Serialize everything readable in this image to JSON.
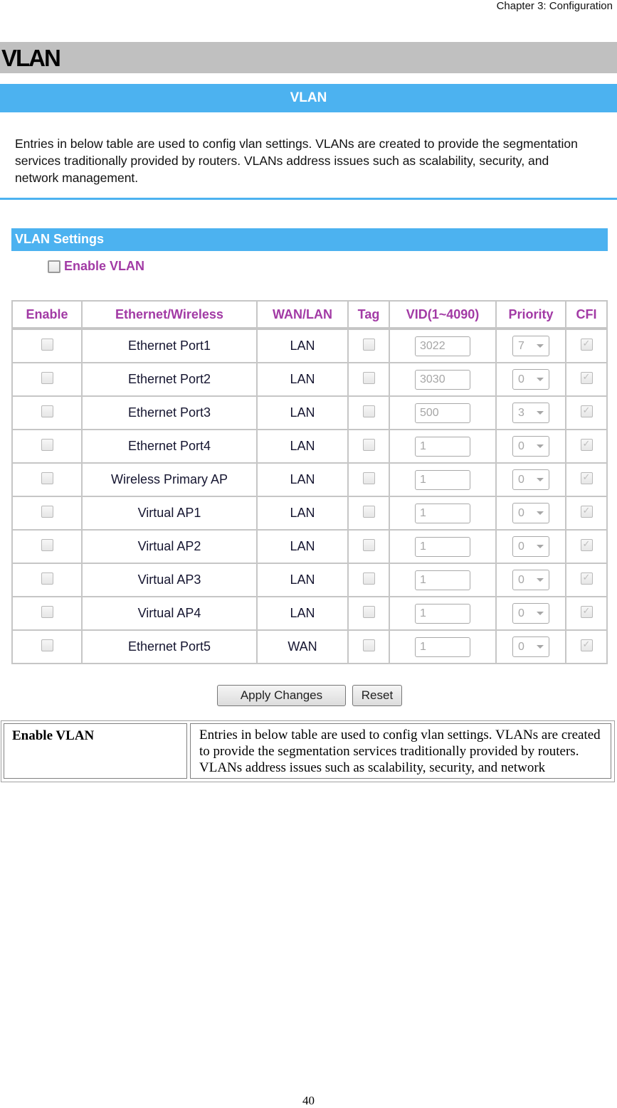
{
  "page": {
    "chapter_header": "Chapter 3: Configuration",
    "section_title": "VLAN",
    "page_number": "40"
  },
  "screen": {
    "title_bar": "VLAN",
    "intro_text": "Entries in below table are used to config vlan settings. VLANs are created to provide the segmentation services traditionally provided by routers. VLANs address issues such as scalability, security, and network management.",
    "settings_title": "VLAN Settings",
    "enable_vlan_label": "Enable VLAN",
    "enable_vlan_checked": false,
    "table": {
      "headers": [
        "Enable",
        "Ethernet/Wireless",
        "WAN/LAN",
        "Tag",
        "VID(1~4090)",
        "Priority",
        "CFI"
      ],
      "rows": [
        {
          "enable": false,
          "name": "Ethernet Port1",
          "wanlan": "LAN",
          "tag": false,
          "vid": "3022",
          "priority": "7",
          "cfi": true
        },
        {
          "enable": false,
          "name": "Ethernet Port2",
          "wanlan": "LAN",
          "tag": false,
          "vid": "3030",
          "priority": "0",
          "cfi": true
        },
        {
          "enable": false,
          "name": "Ethernet Port3",
          "wanlan": "LAN",
          "tag": false,
          "vid": "500",
          "priority": "3",
          "cfi": true
        },
        {
          "enable": false,
          "name": "Ethernet Port4",
          "wanlan": "LAN",
          "tag": false,
          "vid": "1",
          "priority": "0",
          "cfi": true
        },
        {
          "enable": false,
          "name": "Wireless Primary AP",
          "wanlan": "LAN",
          "tag": false,
          "vid": "1",
          "priority": "0",
          "cfi": true
        },
        {
          "enable": false,
          "name": "Virtual AP1",
          "wanlan": "LAN",
          "tag": false,
          "vid": "1",
          "priority": "0",
          "cfi": true
        },
        {
          "enable": false,
          "name": "Virtual AP2",
          "wanlan": "LAN",
          "tag": false,
          "vid": "1",
          "priority": "0",
          "cfi": true
        },
        {
          "enable": false,
          "name": "Virtual AP3",
          "wanlan": "LAN",
          "tag": false,
          "vid": "1",
          "priority": "0",
          "cfi": true
        },
        {
          "enable": false,
          "name": "Virtual AP4",
          "wanlan": "LAN",
          "tag": false,
          "vid": "1",
          "priority": "0",
          "cfi": true
        },
        {
          "enable": false,
          "name": "Ethernet Port5",
          "wanlan": "WAN",
          "tag": false,
          "vid": "1",
          "priority": "0",
          "cfi": true
        }
      ]
    },
    "buttons": {
      "apply": "Apply Changes",
      "reset": "Reset"
    },
    "colors": {
      "header_blue": "#4cb2f0",
      "label_purple": "#a23aa5"
    }
  },
  "description_table": {
    "field": "Enable VLAN",
    "description": "Entries in below table are used to config vlan settings. VLANs are created to provide the segmentation services traditionally provided by routers. VLANs address issues such as scalability, security, and network management."
  }
}
